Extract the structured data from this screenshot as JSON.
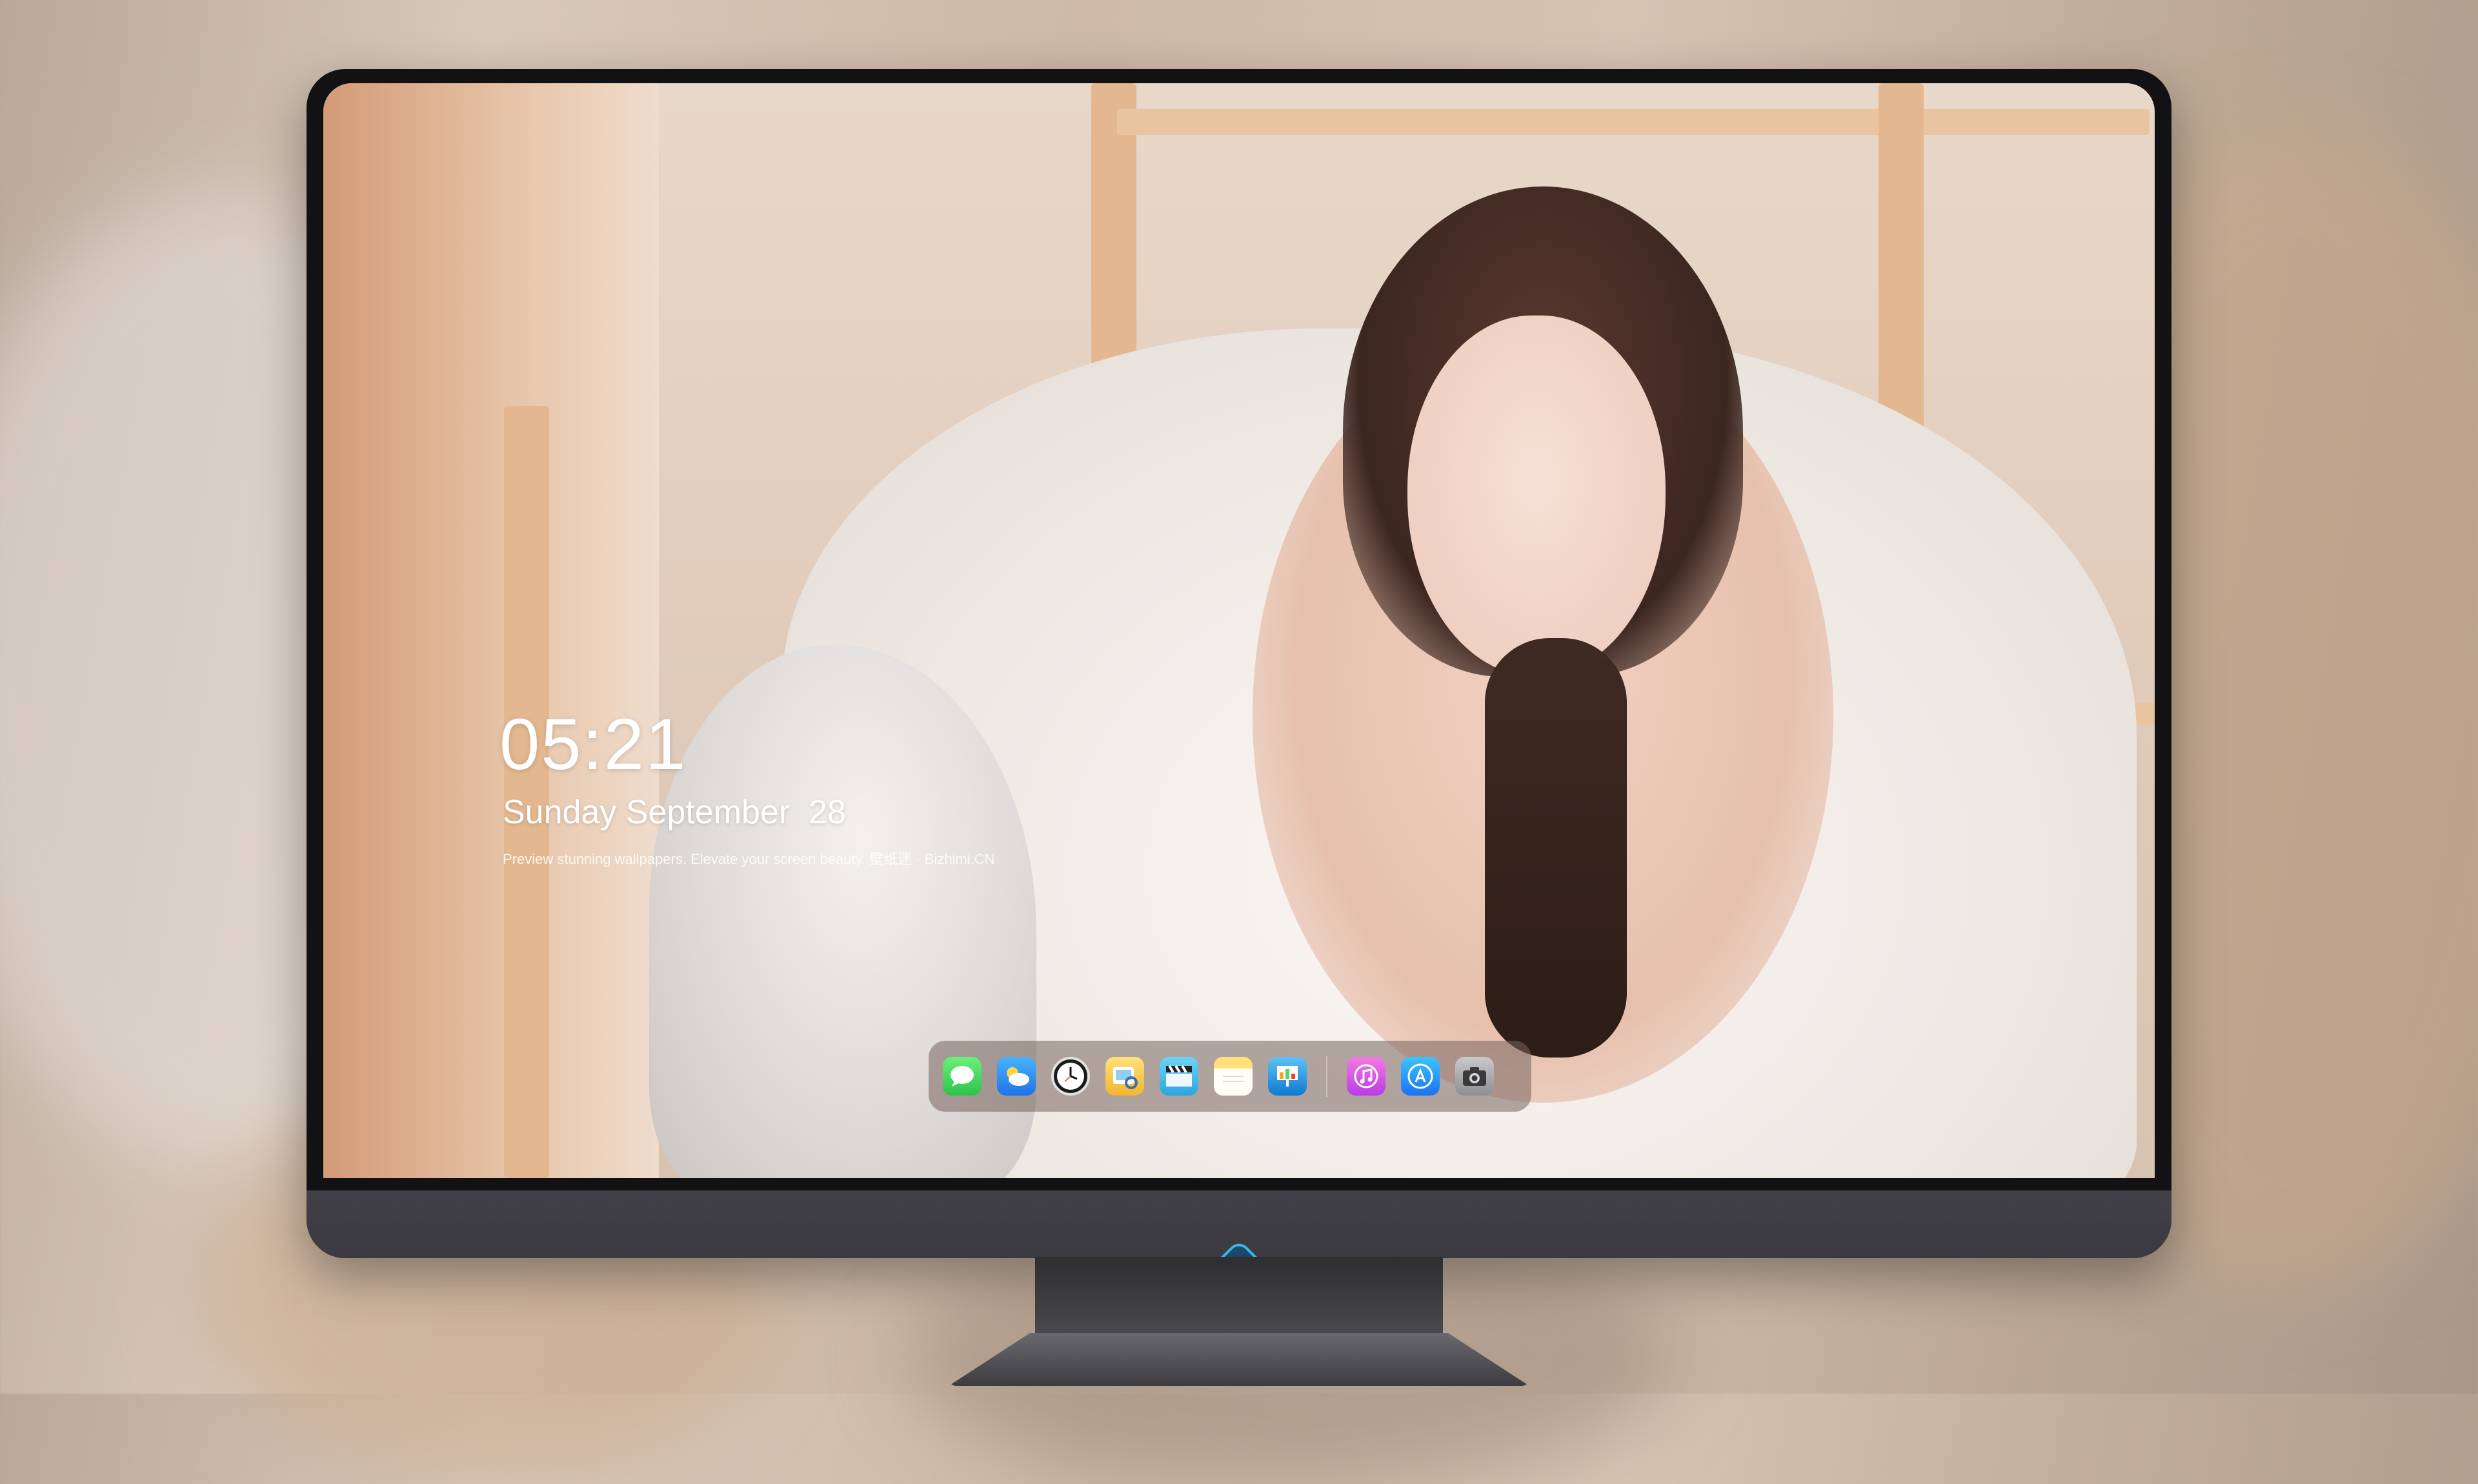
{
  "lockscreen": {
    "time": "05:21",
    "date": "Sunday September  28",
    "tagline": "Preview stunning wallpapers. Elevate your screen beauty. 壁纸迷 · Bizhimi.CN"
  },
  "dock": {
    "apps": [
      {
        "name": "Messages",
        "icon": "messages-icon"
      },
      {
        "name": "Weather",
        "icon": "weather-icon"
      },
      {
        "name": "Clock",
        "icon": "clock-icon"
      },
      {
        "name": "Preview",
        "icon": "preview-icon"
      },
      {
        "name": "Clips",
        "icon": "clips-icon"
      },
      {
        "name": "Notes",
        "icon": "notes-icon"
      },
      {
        "name": "Keynote",
        "icon": "keynote-icon"
      },
      {
        "name": "Music",
        "icon": "music-icon"
      },
      {
        "name": "App Store",
        "icon": "app-store-icon"
      },
      {
        "name": "Camera",
        "icon": "camera-icon"
      }
    ]
  },
  "colors": {
    "bezel": "#121214",
    "chin": "#3b3a40",
    "accent_logo": "#38b8e8"
  }
}
